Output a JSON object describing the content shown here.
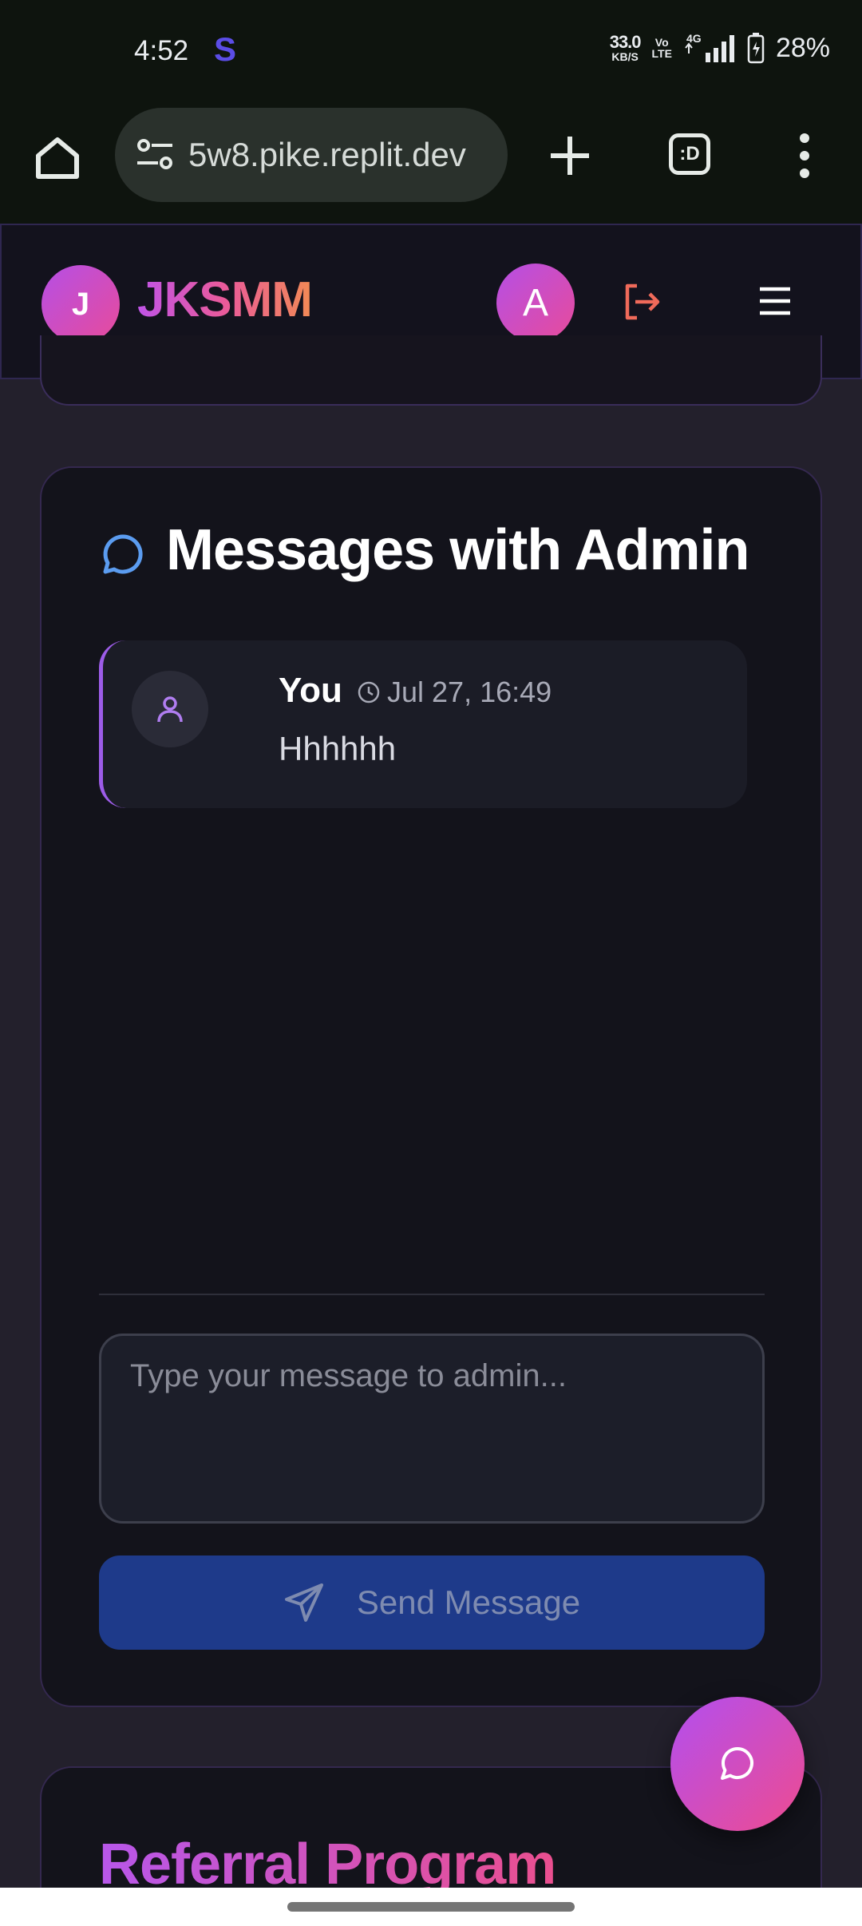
{
  "status_bar": {
    "time": "4:52",
    "app_icon": "S",
    "net_speed_value": "33.0",
    "net_speed_unit": "KB/S",
    "volte_top": "Vo",
    "volte_bottom": "LTE",
    "network": "4G",
    "battery": "28%"
  },
  "browser": {
    "url": "5w8.pike.replit.dev",
    "tab_switcher_label": ":D",
    "icons": [
      "home-icon",
      "site-settings-icon",
      "new-tab-icon",
      "tab-switcher-icon",
      "more-vert-icon"
    ]
  },
  "header": {
    "logo_letter": "J",
    "brand": "JKSMM",
    "user_initial": "A"
  },
  "messages_section": {
    "title": "Messages with Admin",
    "messages": [
      {
        "author": "You",
        "time": "Jul 27, 16:49",
        "body": "Hhhhhh"
      }
    ],
    "input_placeholder": "Type your message to admin...",
    "send_label": "Send Message"
  },
  "referral_section": {
    "title": "Referral Program"
  },
  "colors": {
    "accent_purple": "#b54fe6",
    "accent_pink": "#e84b9a",
    "send_button": "#1e3a8a",
    "card_bg": "#13131b"
  }
}
